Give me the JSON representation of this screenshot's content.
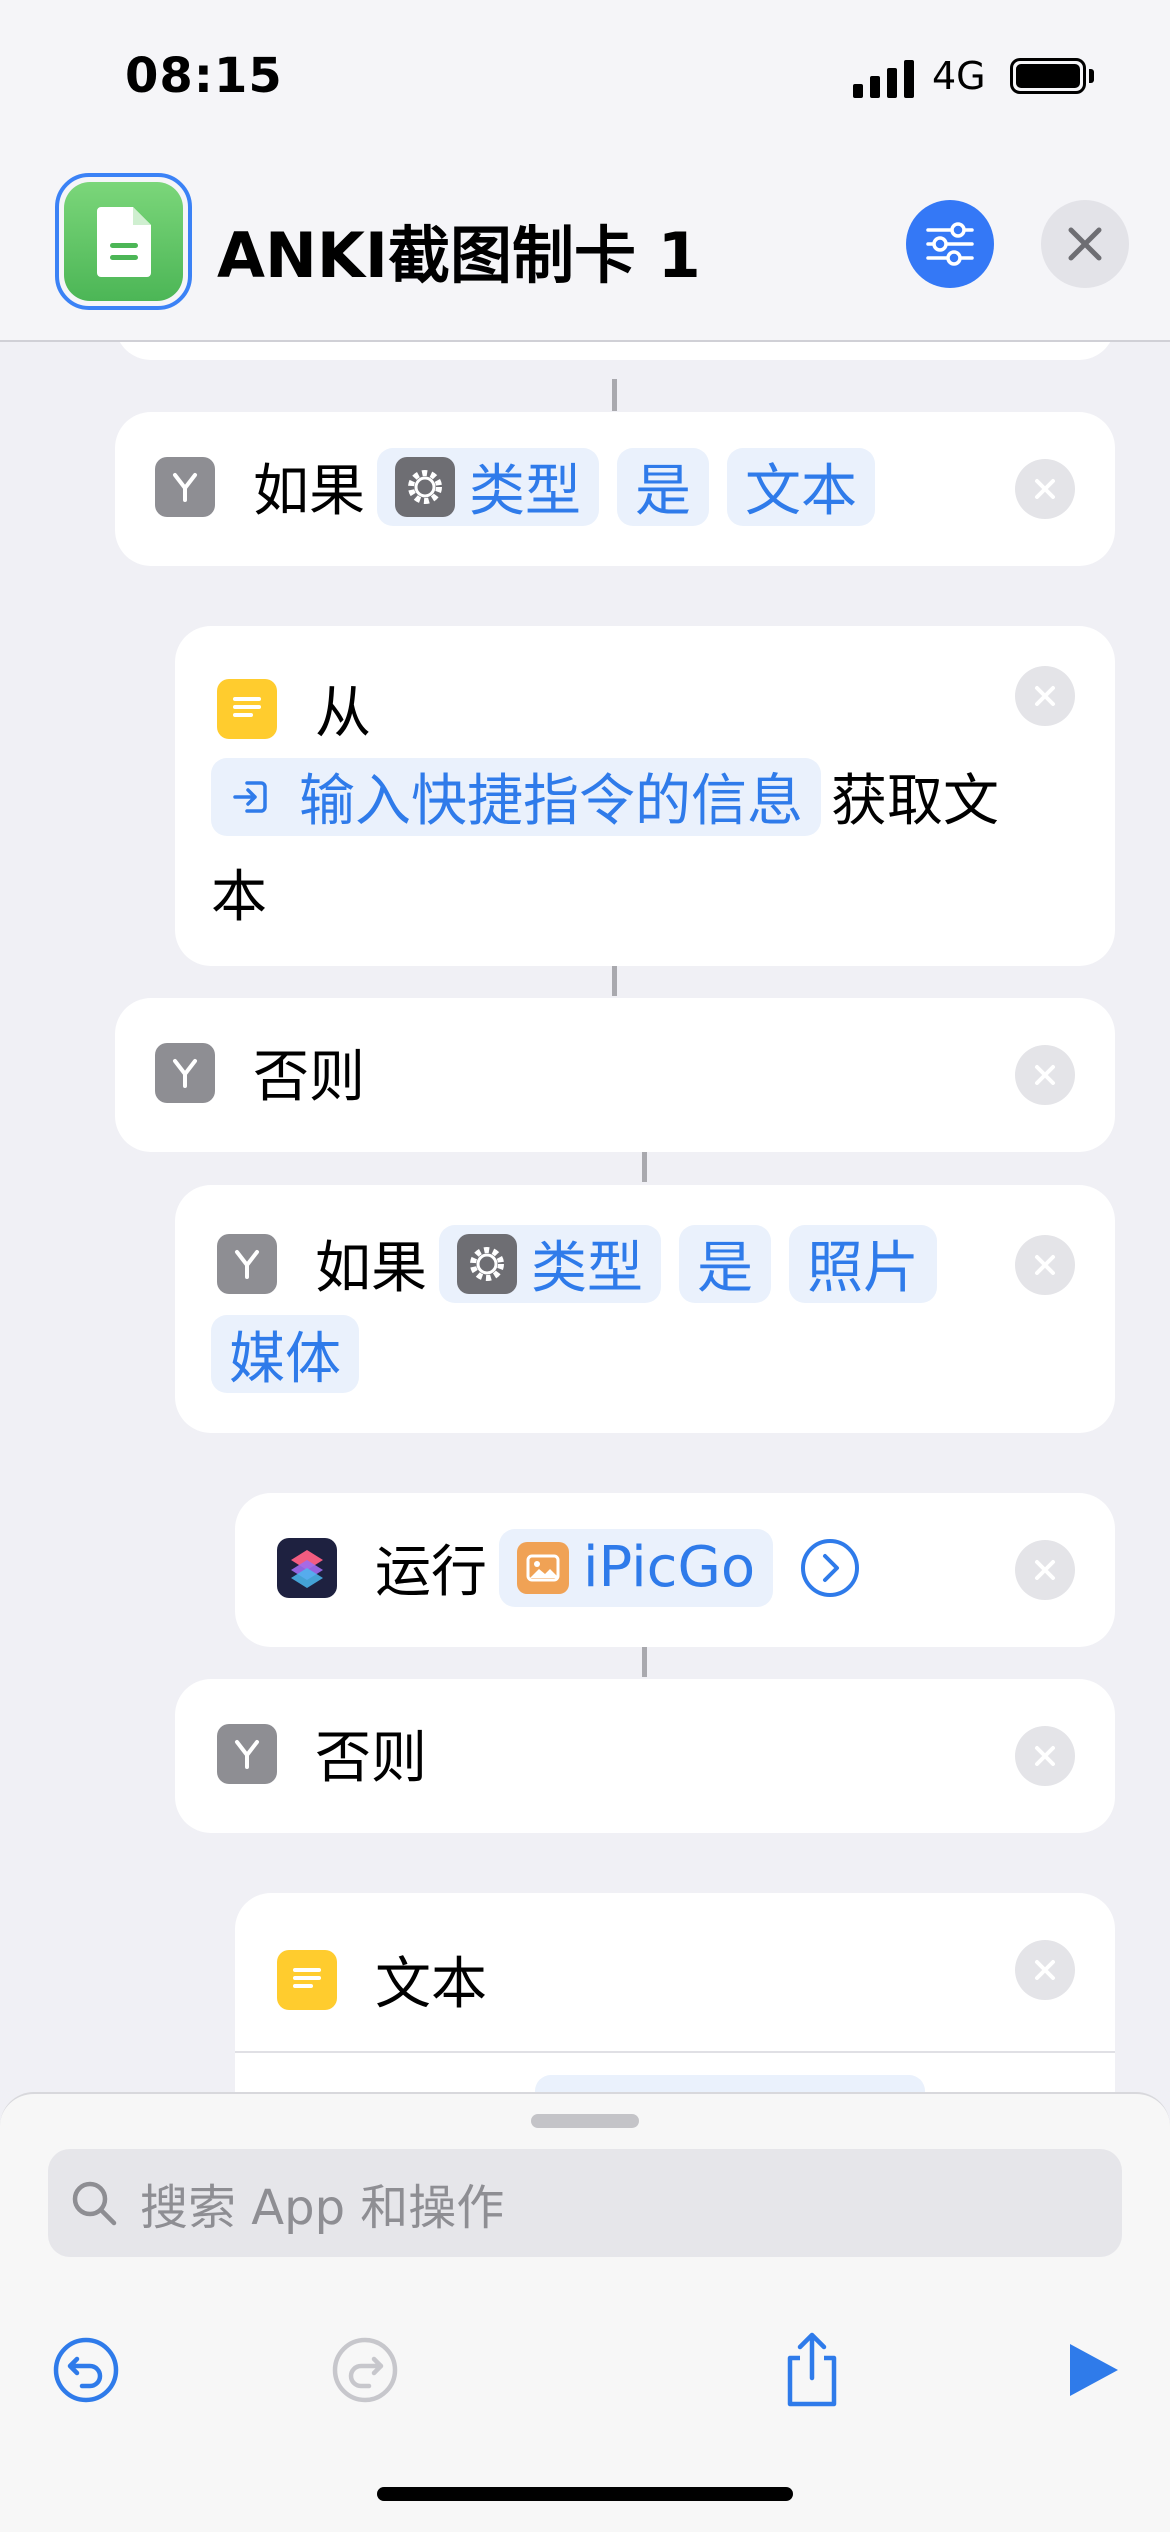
{
  "status_bar": {
    "time": "08:15",
    "network": "4G"
  },
  "header": {
    "title": "ANKI截图制卡 1"
  },
  "workflow": {
    "if1": {
      "keyword": "如果",
      "param": "类型",
      "operator": "是",
      "value": "文本"
    },
    "get_text": {
      "prefix": "从",
      "source": "输入快捷指令的信息",
      "suffix_line1": "获取文",
      "suffix_line2": "本"
    },
    "otherwise1": {
      "keyword": "否则"
    },
    "if2": {
      "keyword": "如果",
      "param": "类型",
      "operator": "是",
      "value_line1": "照片",
      "value_line2": "媒体"
    },
    "run": {
      "keyword": "运行",
      "shortcut": "iPicGo"
    },
    "otherwise2": {
      "keyword": "否则"
    },
    "text": {
      "keyword": "文本"
    }
  },
  "bottom_sheet": {
    "search_placeholder": "搜索 App 和操作"
  },
  "colors": {
    "accent": "#3478F6",
    "token_bg": "#EAF1FC",
    "token_text": "#2F7BEA"
  }
}
